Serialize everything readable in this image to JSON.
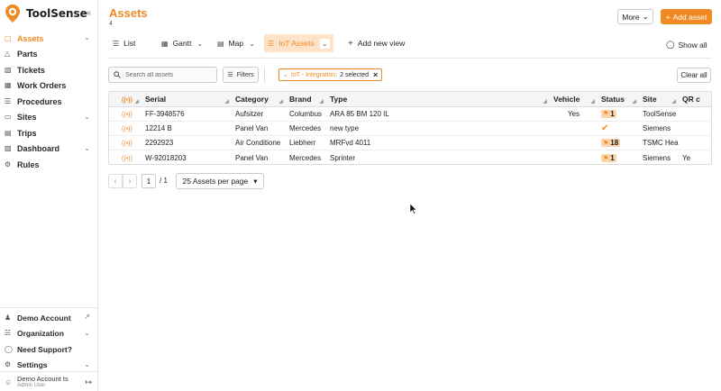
{
  "app": {
    "name": "ToolSense"
  },
  "sidebar": {
    "items": [
      {
        "label": "Assets",
        "icon": "box-icon",
        "active": true,
        "has_chevron": true
      },
      {
        "label": "Parts",
        "icon": "parts-icon",
        "active": false,
        "has_chevron": false
      },
      {
        "label": "Tickets",
        "icon": "ticket-icon",
        "active": false,
        "has_chevron": false
      },
      {
        "label": "Work Orders",
        "icon": "work-orders-icon",
        "active": false,
        "has_chevron": false
      },
      {
        "label": "Procedures",
        "icon": "procedures-icon",
        "active": false,
        "has_chevron": false
      },
      {
        "label": "Sites",
        "icon": "sites-icon",
        "active": false,
        "has_chevron": true
      },
      {
        "label": "Trips",
        "icon": "trips-icon",
        "active": false,
        "has_chevron": false
      },
      {
        "label": "Dashboard",
        "icon": "dashboard-icon",
        "active": false,
        "has_chevron": true
      },
      {
        "label": "Rules",
        "icon": "rules-icon",
        "active": false,
        "has_chevron": false
      }
    ],
    "bottom": [
      {
        "label": "Demo Account",
        "icon": "users-icon",
        "trailing": "↗"
      },
      {
        "label": "Organization",
        "icon": "organization-icon",
        "trailing": "⌄"
      },
      {
        "label": "Need Support?",
        "icon": "help-icon",
        "trailing": ""
      },
      {
        "label": "Settings",
        "icon": "gear-icon",
        "trailing": "⌄"
      }
    ],
    "user": {
      "name": "Demo Account ts",
      "role": "Admin User"
    }
  },
  "header": {
    "title": "Assets",
    "count": "4",
    "more_label": "More",
    "add_label": "Add asset"
  },
  "views": {
    "tabs": [
      {
        "label": "List",
        "icon": "list-icon"
      },
      {
        "label": "Gantt",
        "icon": "gantt-icon"
      },
      {
        "label": "Map",
        "icon": "map-icon"
      },
      {
        "label": "IoT Assets",
        "icon": "iot-list-icon",
        "active": true
      }
    ],
    "add_view_label": "Add new view",
    "show_all_label": "Show all"
  },
  "toolbar": {
    "search_placeholder": "Search all assets",
    "filters_label": "Filters",
    "chip_key": "IoT - Integration:",
    "chip_value": "2 selected",
    "clear_all_label": "Clear all"
  },
  "table": {
    "headers": [
      "Serial",
      "Category",
      "Brand",
      "Type",
      "Vehicle",
      "Status",
      "Site",
      "QR c"
    ],
    "rows": [
      {
        "serial": "FF-3948576",
        "category": "Aufsitzer",
        "brand": "Columbus",
        "type": "ARA 85 BM 120 IL",
        "vehicle": "Yes",
        "status": "1",
        "status_kind": "tag",
        "site": "ToolSense",
        "qr": ""
      },
      {
        "serial": "12214 B",
        "category": "Panel Van",
        "brand": "Mercedes",
        "type": "new type",
        "vehicle": "",
        "status": "",
        "status_kind": "check",
        "site": "Siemens",
        "qr": ""
      },
      {
        "serial": "2292923",
        "category": "Air Conditione",
        "brand": "Liebherr",
        "type": "MRFvd 4011",
        "vehicle": "",
        "status": "18",
        "status_kind": "tag",
        "site": "TSMC Hea",
        "qr": ""
      },
      {
        "serial": "W-92018203",
        "category": "Panel Van",
        "brand": "Mercedes",
        "type": "Sprinter",
        "vehicle": "",
        "status": "1",
        "status_kind": "tag",
        "site": "Siemens",
        "qr": "Ye"
      }
    ]
  },
  "pagination": {
    "current_page": "1",
    "total": "/ 1",
    "per_page_label": "25 Assets per page"
  },
  "colors": {
    "accent": "#f08a24",
    "accent_light": "#fde3c8"
  }
}
